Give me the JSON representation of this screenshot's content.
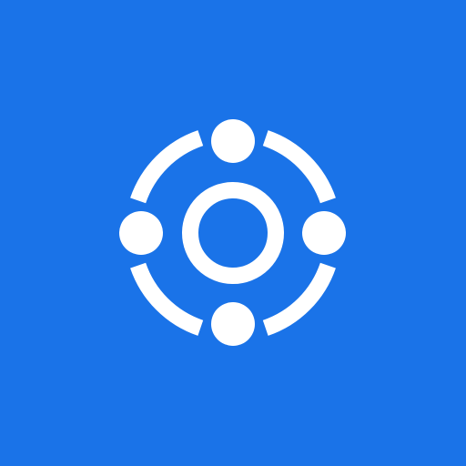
{
  "colors": {
    "background": "#1A73E8",
    "foreground": "#FFFFFF"
  },
  "icon": {
    "name": "orbit-network-icon",
    "parts": [
      "center-ring",
      "outer-arc-segments",
      "satellite-dots"
    ]
  }
}
